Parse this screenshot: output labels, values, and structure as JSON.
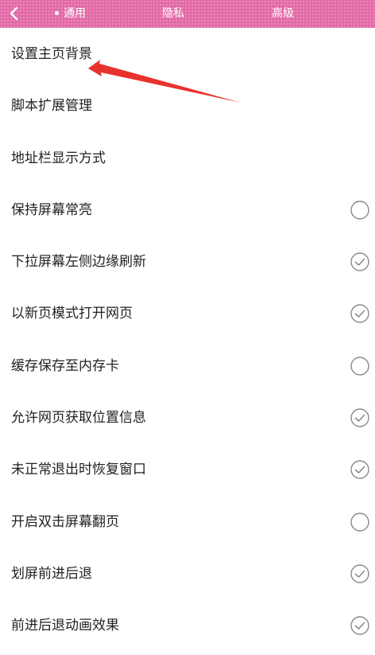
{
  "header": {
    "back_icon": "chevron-left-icon",
    "tabs": [
      {
        "label": "通用",
        "active": true
      },
      {
        "label": "隐私",
        "active": false
      },
      {
        "label": "高级",
        "active": false
      }
    ],
    "background_color": "#e26aa6"
  },
  "settings": [
    {
      "label": "设置主页背景"
    },
    {
      "label": "脚本扩展管理"
    },
    {
      "label": "地址栏显示方式"
    },
    {
      "label": "保持屏幕常亮",
      "checked": false
    },
    {
      "label": "下拉屏幕左侧边缘刷新",
      "checked": true
    },
    {
      "label": "以新页模式打开网页",
      "checked": true
    },
    {
      "label": "缓存保存至内存卡",
      "checked": false
    },
    {
      "label": "允许网页获取位置信息",
      "checked": true
    },
    {
      "label": "未正常退出时恢复窗口",
      "checked": true
    },
    {
      "label": "开启双击屏幕翻页",
      "checked": false
    },
    {
      "label": "划屏前进后退",
      "checked": true
    },
    {
      "label": "前进后退动画效果",
      "checked": true
    }
  ],
  "annotation": {
    "color": "#e8322e",
    "icon": "red-arrow-annotation"
  }
}
